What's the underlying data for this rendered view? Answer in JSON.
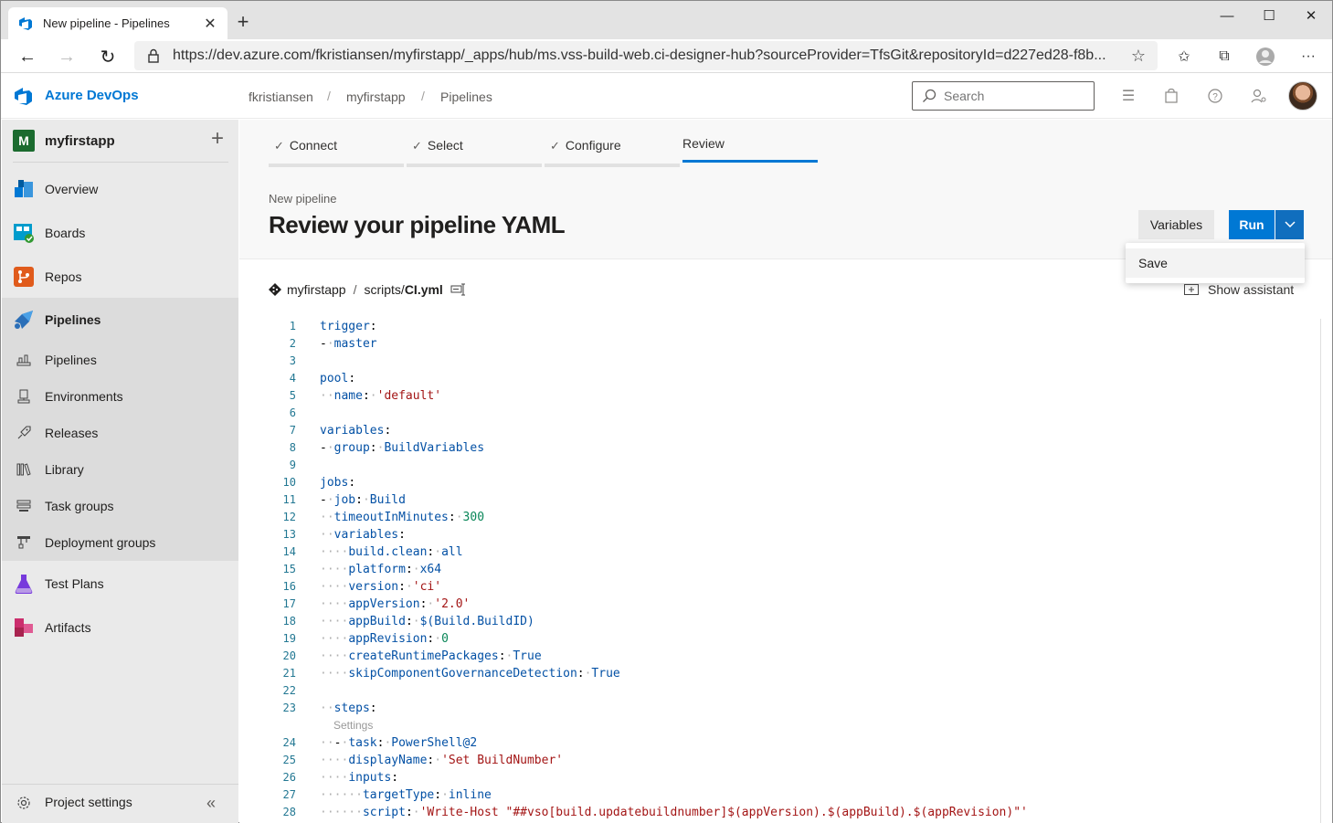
{
  "browser": {
    "tab_title": "New pipeline - Pipelines",
    "url": "https://dev.azure.com/fkristiansen/myfirstapp/_apps/hub/ms.vss-build-web.ci-designer-hub?sourceProvider=TfsGit&repositoryId=d227ed28-f8b..."
  },
  "header": {
    "product_name": "Azure DevOps",
    "breadcrumb": [
      "fkristiansen",
      "myfirstapp",
      "Pipelines"
    ],
    "search_placeholder": "Search"
  },
  "sidebar": {
    "project_initial": "M",
    "project_name": "myfirstapp",
    "items": [
      {
        "label": "Overview",
        "icon": "overview-icon"
      },
      {
        "label": "Boards",
        "icon": "boards-icon"
      },
      {
        "label": "Repos",
        "icon": "repos-icon"
      },
      {
        "label": "Pipelines",
        "icon": "pipelines-icon"
      },
      {
        "label": "Test Plans",
        "icon": "test-plans-icon"
      },
      {
        "label": "Artifacts",
        "icon": "artifacts-icon"
      }
    ],
    "pipeline_subitems": [
      {
        "label": "Pipelines",
        "icon": "pipelines-sub-icon"
      },
      {
        "label": "Environments",
        "icon": "environments-icon"
      },
      {
        "label": "Releases",
        "icon": "releases-icon"
      },
      {
        "label": "Library",
        "icon": "library-icon"
      },
      {
        "label": "Task groups",
        "icon": "task-groups-icon"
      },
      {
        "label": "Deployment groups",
        "icon": "deployment-groups-icon"
      }
    ],
    "settings_label": "Project settings"
  },
  "wizard": {
    "steps": [
      {
        "label": "Connect",
        "done": true
      },
      {
        "label": "Select",
        "done": true
      },
      {
        "label": "Configure",
        "done": true
      },
      {
        "label": "Review",
        "done": false,
        "active": true
      }
    ]
  },
  "page": {
    "subtitle": "New pipeline",
    "title": "Review your pipeline YAML",
    "variables_button": "Variables",
    "run_button": "Run",
    "menu_items": [
      "Save"
    ],
    "file_repo": "myfirstapp",
    "file_dir": "scripts/",
    "file_name": "CI.yml",
    "show_assistant": "Show assistant"
  },
  "editor": {
    "codelens": "Settings",
    "lines": [
      {
        "n": "1",
        "t": "trigger:"
      },
      {
        "n": "2",
        "t": "- master"
      },
      {
        "n": "3",
        "t": ""
      },
      {
        "n": "4",
        "t": "pool:"
      },
      {
        "n": "5",
        "t": "  name: 'default'"
      },
      {
        "n": "6",
        "t": ""
      },
      {
        "n": "7",
        "t": "variables:"
      },
      {
        "n": "8",
        "t": "- group: BuildVariables"
      },
      {
        "n": "9",
        "t": ""
      },
      {
        "n": "10",
        "t": "jobs:"
      },
      {
        "n": "11",
        "t": "- job: Build"
      },
      {
        "n": "12",
        "t": "  timeoutInMinutes: 300"
      },
      {
        "n": "13",
        "t": "  variables:"
      },
      {
        "n": "14",
        "t": "    build.clean: all"
      },
      {
        "n": "15",
        "t": "    platform: x64"
      },
      {
        "n": "16",
        "t": "    version: 'ci'"
      },
      {
        "n": "17",
        "t": "    appVersion: '2.0'"
      },
      {
        "n": "18",
        "t": "    appBuild: $(Build.BuildID)"
      },
      {
        "n": "19",
        "t": "    appRevision: 0"
      },
      {
        "n": "20",
        "t": "    createRuntimePackages: True"
      },
      {
        "n": "21",
        "t": "    skipComponentGovernanceDetection: True"
      },
      {
        "n": "22",
        "t": ""
      },
      {
        "n": "23",
        "t": "  steps:"
      },
      {
        "n": "24",
        "t": "  - task: PowerShell@2"
      },
      {
        "n": "25",
        "t": "    displayName: 'Set BuildNumber'"
      },
      {
        "n": "26",
        "t": "    inputs:"
      },
      {
        "n": "27",
        "t": "      targetType: inline"
      },
      {
        "n": "28",
        "t": "      script: 'Write-Host \"##vso[build.updatebuildnumber]$(appVersion).$(appBuild).$(appRevision)\"'"
      }
    ]
  },
  "colors": {
    "accent": "#0078d4",
    "nav_bg": "#eaeaea",
    "yaml_key": "#0451a5",
    "yaml_string": "#a31515",
    "yaml_number": "#098658"
  }
}
